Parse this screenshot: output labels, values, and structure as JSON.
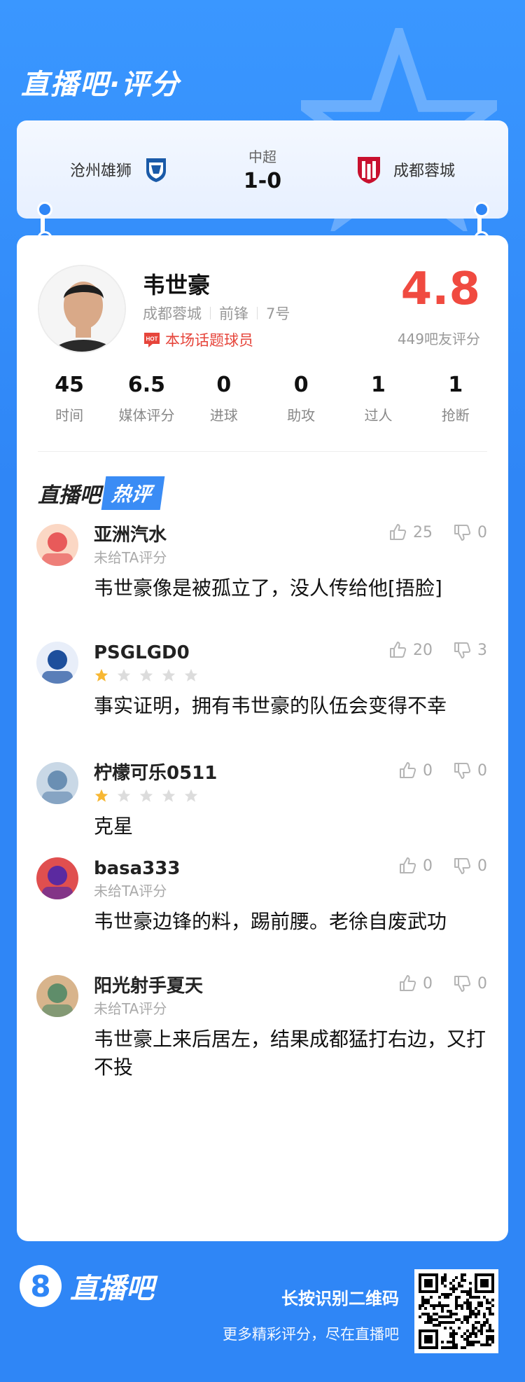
{
  "header": {
    "title": "直播吧·评分"
  },
  "match": {
    "home_team": "沧州雄狮",
    "away_team": "成都蓉城",
    "league": "中超",
    "score": "1-0"
  },
  "player": {
    "name": "韦世豪",
    "team": "成都蓉城",
    "position": "前锋",
    "number": "7号",
    "tag": "本场话题球员",
    "rating": "4.8",
    "rating_sub": "449吧友评分"
  },
  "stats": [
    {
      "value": "45",
      "label": "时间"
    },
    {
      "value": "6.5",
      "label": "媒体评分"
    },
    {
      "value": "0",
      "label": "进球"
    },
    {
      "value": "0",
      "label": "助攻"
    },
    {
      "value": "1",
      "label": "过人"
    },
    {
      "value": "1",
      "label": "抢断"
    }
  ],
  "hot_comments_title": {
    "a": "直播吧",
    "b": "热评"
  },
  "comments": [
    {
      "user": "亚洲汽水",
      "rating_text": "未给TA评分",
      "stars": 0,
      "likes": "25",
      "dislikes": "0",
      "text": "韦世豪像是被孤立了，没人传给他[捂脸]"
    },
    {
      "user": "PSGLGD0",
      "rating_text": "",
      "stars": 1,
      "likes": "20",
      "dislikes": "3",
      "text": "事实证明，拥有韦世豪的队伍会变得不幸"
    },
    {
      "user": "柠檬可乐0511",
      "rating_text": "",
      "stars": 1,
      "likes": "0",
      "dislikes": "0",
      "text": "克星"
    },
    {
      "user": "basa333",
      "rating_text": "未给TA评分",
      "stars": 0,
      "likes": "0",
      "dislikes": "0",
      "text": "韦世豪边锋的料，踢前腰。老徐自废武功"
    },
    {
      "user": "阳光射手夏天",
      "rating_text": "未给TA评分",
      "stars": 0,
      "likes": "0",
      "dislikes": "0",
      "text": "韦世豪上来后居左，结果成都猛打右边，又打不投"
    }
  ],
  "footer": {
    "logo_glyph": "8",
    "logo_text": "直播吧",
    "line1": "长按识别二维码",
    "line2": "更多精彩评分，尽在直播吧"
  },
  "colors": {
    "brand_blue": "#2f86f6",
    "rating_red": "#f04a40",
    "star_gold": "#f7b733"
  }
}
